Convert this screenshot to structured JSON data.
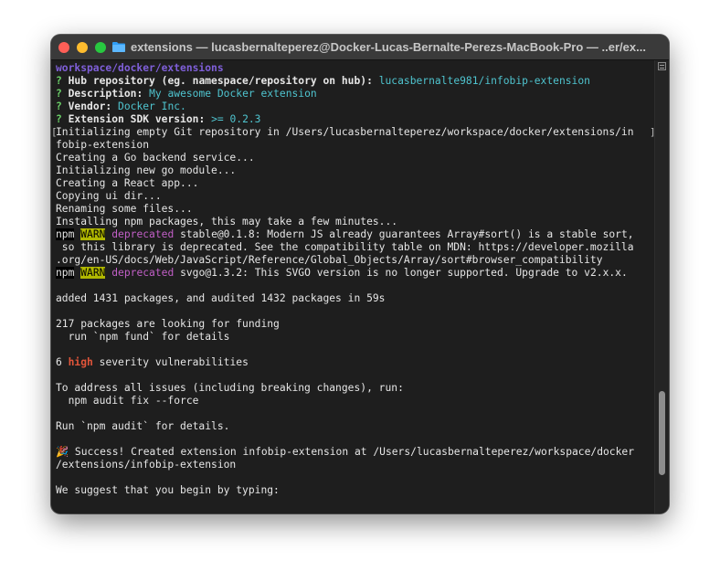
{
  "window": {
    "title": "extensions — lucasbernalteperez@Docker-Lucas-Bernalte-Perezs-MacBook-Pro — ..er/ex..."
  },
  "icons": {
    "folder": "folder-icon",
    "scroll_button": "scrollbar-button-icon"
  },
  "colors": {
    "background": "#1e1e1e",
    "titlebar": "#3a3a3a",
    "prompt_green": "#6bd168",
    "answer_cyan": "#4fc4cf",
    "path_purple": "#7f5fd9",
    "deprecated_magenta": "#c25fc7",
    "warn_background": "#b1b800",
    "high_red": "#e2553a"
  },
  "terminal": {
    "path": "workspace/docker/extensions",
    "q1": {
      "mark": "?",
      "prompt": "Hub repository (eg. namespace/repository on hub):",
      "answer": "lucasbernalte981/infobip-extension"
    },
    "q2": {
      "mark": "?",
      "prompt": "Description:",
      "answer": "My awesome Docker extension"
    },
    "q3": {
      "mark": "?",
      "prompt": "Vendor:",
      "answer": "Docker Inc."
    },
    "q4": {
      "mark": "?",
      "prompt": "Extension SDK version:",
      "answer": ">= 0.2.3"
    },
    "line_git_1": "Initializing empty Git repository in /Users/lucasbernalteperez/workspace/docker/extensions/in",
    "line_git_2": "fobip-extension",
    "line_backend": "Creating a Go backend service...",
    "line_gomod": "Initializing new go module...",
    "line_react": "Creating a React app...",
    "line_copy": "Copying ui dir...",
    "line_rename": "Renaming some files...",
    "line_install": "Installing npm packages, this may take a few minutes...",
    "warn1": {
      "npm": "npm",
      "warn": "WARN",
      "deprecated": "deprecated",
      "text": "stable@0.1.8: Modern JS already guarantees Array#sort() is a stable sort,",
      "cont1": " so this library is deprecated. See the compatibility table on MDN: https://developer.mozilla",
      "cont2": ".org/en-US/docs/Web/JavaScript/Reference/Global_Objects/Array/sort#browser_compatibility"
    },
    "warn2": {
      "npm": "npm",
      "warn": "WARN",
      "deprecated": "deprecated",
      "text": "svgo@1.3.2: This SVGO version is no longer supported. Upgrade to v2.x.x."
    },
    "line_added": "added 1431 packages, and audited 1432 packages in 59s",
    "line_funding": "217 packages are looking for funding",
    "line_fund_cmd": "  run `npm fund` for details",
    "vuln": {
      "count": "6",
      "severity": "high",
      "text": "severity vulnerabilities"
    },
    "line_address": "To address all issues (including breaking changes), run:",
    "line_fix": "  npm audit fix --force",
    "line_run_audit": "Run `npm audit` for details.",
    "success": {
      "emoji": "🎉",
      "text1": "Success! Created extension infobip-extension at /Users/lucasbernalteperez/workspace/docker",
      "text2": "/extensions/infobip-extension"
    },
    "line_suggest": "We suggest that you begin by typing:",
    "bracket_left": "[",
    "bracket_right": "]"
  }
}
